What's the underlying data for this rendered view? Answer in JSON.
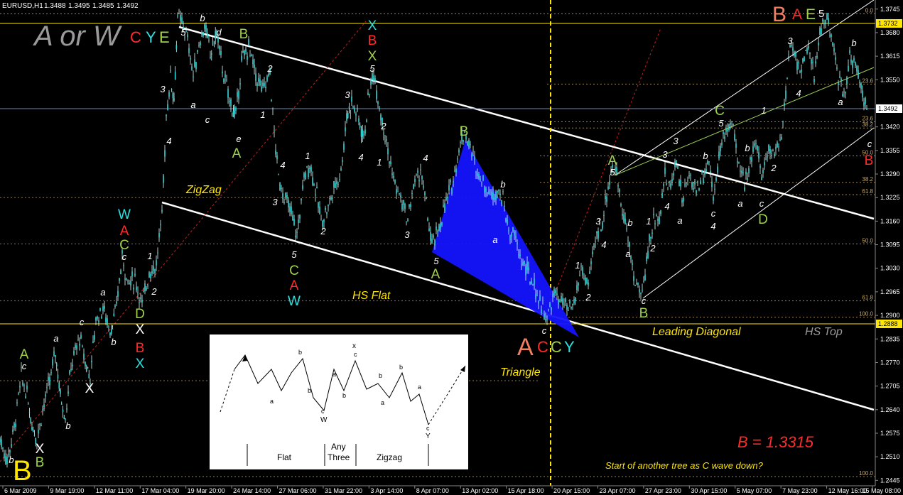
{
  "chart_data": {
    "type": "candlestick",
    "symbol": "EURUSD,H1",
    "ohlc": [
      "1.3488",
      "1.3495",
      "1.3485",
      "1.3492"
    ],
    "ylim": [
      1.243,
      1.377
    ],
    "y_ticks": [
      "1.3745",
      "1.3680",
      "1.3615",
      "1.3550",
      "1.3420",
      "1.3355",
      "1.3290",
      "1.3225",
      "1.3160",
      "1.3095",
      "1.3030",
      "1.2965",
      "1.2900",
      "1.2835",
      "1.2770",
      "1.2705",
      "1.2640",
      "1.2575",
      "1.2510",
      "1.2445"
    ],
    "current_price": "1.3492",
    "top_price": "1.3732",
    "low_price": "1.2888",
    "x_ticks": [
      "6 Mar 2009",
      "9 Mar 19:00",
      "12 Mar 11:00",
      "17 Mar 04:00",
      "19 Mar 20:00",
      "24 Mar 14:00",
      "27 Mar 06:00",
      "31 Mar 22:00",
      "3 Apr 14:00",
      "8 Apr 07:00",
      "13 Apr 02:00",
      "15 Apr 18:00",
      "20 Apr 15:00",
      "23 Apr 07:00",
      "27 Apr 23:00",
      "30 Apr 15:00",
      "5 May 07:00",
      "7 May 23:00",
      "12 May 16:00",
      "15 May 08:00"
    ],
    "fib_levels": [
      {
        "label": "0.0",
        "price": 1.3732
      },
      {
        "label": "23.6",
        "price": 1.3434
      },
      {
        "label": "38.2",
        "price": 1.3417
      },
      {
        "label": "50.0",
        "price": 1.334
      },
      {
        "label": "38.2",
        "price": 1.3267
      },
      {
        "label": "61.8",
        "price": 1.3233
      },
      {
        "label": "50.0",
        "price": 1.3097
      },
      {
        "label": "61.8",
        "price": 1.294
      },
      {
        "label": "100.0",
        "price": 1.2895
      },
      {
        "label": "100.0",
        "price": 1.2455
      },
      {
        "label": "23.6",
        "price": 1.3538
      }
    ],
    "price_path": [
      [
        0,
        1.256
      ],
      [
        10,
        1.25
      ],
      [
        20,
        1.259
      ],
      [
        30,
        1.273
      ],
      [
        38,
        1.268
      ],
      [
        45,
        1.26
      ],
      [
        52,
        1.256
      ],
      [
        60,
        1.264
      ],
      [
        70,
        1.272
      ],
      [
        78,
        1.28
      ],
      [
        85,
        1.268
      ],
      [
        92,
        1.262
      ],
      [
        100,
        1.276
      ],
      [
        112,
        1.284
      ],
      [
        120,
        1.277
      ],
      [
        127,
        1.273
      ],
      [
        135,
        1.289
      ],
      [
        145,
        1.292
      ],
      [
        155,
        1.286
      ],
      [
        162,
        1.29
      ],
      [
        172,
        1.306
      ],
      [
        180,
        1.299
      ],
      [
        190,
        1.3
      ],
      [
        200,
        1.293
      ],
      [
        210,
        1.302
      ],
      [
        220,
        1.304
      ],
      [
        228,
        1.318
      ],
      [
        234,
        1.345
      ],
      [
        240,
        1.356
      ],
      [
        245,
        1.35
      ],
      [
        250,
        1.372
      ],
      [
        258,
        1.37
      ],
      [
        266,
        1.364
      ],
      [
        272,
        1.356
      ],
      [
        280,
        1.365
      ],
      [
        288,
        1.37
      ],
      [
        296,
        1.362
      ],
      [
        305,
        1.368
      ],
      [
        315,
        1.356
      ],
      [
        325,
        1.348
      ],
      [
        332,
        1.345
      ],
      [
        340,
        1.36
      ],
      [
        350,
        1.364
      ],
      [
        360,
        1.356
      ],
      [
        370,
        1.352
      ],
      [
        380,
        1.357
      ],
      [
        386,
        1.34
      ],
      [
        392,
        1.328
      ],
      [
        400,
        1.323
      ],
      [
        410,
        1.318
      ],
      [
        418,
        1.312
      ],
      [
        428,
        1.328
      ],
      [
        436,
        1.332
      ],
      [
        444,
        1.325
      ],
      [
        452,
        1.316
      ],
      [
        462,
        1.32
      ],
      [
        470,
        1.325
      ],
      [
        480,
        1.33
      ],
      [
        488,
        1.345
      ],
      [
        495,
        1.349
      ],
      [
        505,
        1.344
      ],
      [
        512,
        1.339
      ],
      [
        520,
        1.352
      ],
      [
        526,
        1.357
      ],
      [
        534,
        1.348
      ],
      [
        540,
        1.342
      ],
      [
        548,
        1.333
      ],
      [
        556,
        1.326
      ],
      [
        566,
        1.321
      ],
      [
        574,
        1.316
      ],
      [
        582,
        1.326
      ],
      [
        592,
        1.33
      ],
      [
        600,
        1.32
      ],
      [
        608,
        1.309
      ],
      [
        616,
        1.313
      ],
      [
        626,
        1.32
      ],
      [
        636,
        1.326
      ],
      [
        646,
        1.336
      ],
      [
        654,
        1.341
      ],
      [
        662,
        1.336
      ],
      [
        672,
        1.33
      ],
      [
        682,
        1.326
      ],
      [
        692,
        1.323
      ],
      [
        700,
        1.325
      ],
      [
        708,
        1.322
      ],
      [
        716,
        1.313
      ],
      [
        724,
        1.312
      ],
      [
        732,
        1.306
      ],
      [
        742,
        1.302
      ],
      [
        752,
        1.298
      ],
      [
        762,
        1.293
      ],
      [
        770,
        1.289
      ],
      [
        780,
        1.296
      ],
      [
        790,
        1.294
      ],
      [
        800,
        1.291
      ],
      [
        808,
        1.293
      ],
      [
        818,
        1.303
      ],
      [
        828,
        1.298
      ],
      [
        838,
        1.311
      ],
      [
        848,
        1.316
      ],
      [
        856,
        1.326
      ],
      [
        864,
        1.333
      ],
      [
        872,
        1.324
      ],
      [
        880,
        1.316
      ],
      [
        886,
        1.308
      ],
      [
        894,
        1.299
      ],
      [
        904,
        1.296
      ],
      [
        912,
        1.308
      ],
      [
        920,
        1.316
      ],
      [
        928,
        1.318
      ],
      [
        936,
        1.328
      ],
      [
        944,
        1.325
      ],
      [
        952,
        1.334
      ],
      [
        960,
        1.322
      ],
      [
        970,
        1.328
      ],
      [
        980,
        1.325
      ],
      [
        990,
        1.329
      ],
      [
        998,
        1.333
      ],
      [
        1004,
        1.323
      ],
      [
        1012,
        1.334
      ],
      [
        1020,
        1.34
      ],
      [
        1030,
        1.344
      ],
      [
        1040,
        1.33
      ],
      [
        1048,
        1.327
      ],
      [
        1056,
        1.333
      ],
      [
        1064,
        1.338
      ],
      [
        1072,
        1.328
      ],
      [
        1080,
        1.336
      ],
      [
        1090,
        1.335
      ],
      [
        1100,
        1.34
      ],
      [
        1106,
        1.35
      ],
      [
        1112,
        1.366
      ],
      [
        1120,
        1.361
      ],
      [
        1128,
        1.358
      ],
      [
        1136,
        1.364
      ],
      [
        1146,
        1.356
      ],
      [
        1156,
        1.37
      ],
      [
        1164,
        1.372
      ],
      [
        1172,
        1.364
      ],
      [
        1180,
        1.356
      ],
      [
        1188,
        1.35
      ],
      [
        1196,
        1.362
      ],
      [
        1206,
        1.358
      ],
      [
        1214,
        1.352
      ],
      [
        1222,
        1.345
      ]
    ]
  },
  "labels": {
    "a_or_w": "A or W",
    "c": "C",
    "y": "Y",
    "e": "E",
    "top_b": "B",
    "top_a": "A",
    "top_e": "E",
    "top_5": "5",
    "zigzag": "ZigZag",
    "hs_flat": "HS Flat",
    "triangle": "Triangle",
    "leading_diagonal": "Leading Diagonal",
    "hs_top": "HS Top",
    "b_value": "B = 1.3315",
    "question": "Start of another tree  as C wave down?",
    "big_a": "A",
    "big_b": "B"
  },
  "wave_labels": [
    {
      "t": "b",
      "x": 285,
      "y": 30,
      "c": "#ffffff",
      "s": 13
    },
    {
      "t": "5",
      "x": 258,
      "y": 50,
      "c": "#ffffff",
      "s": 13
    },
    {
      "t": "d",
      "x": 308,
      "y": 50,
      "c": "#ffffff",
      "s": 13
    },
    {
      "t": "B",
      "x": 343,
      "y": 54,
      "c": "#9fd24a",
      "s": 19
    },
    {
      "t": "X",
      "x": 524,
      "y": 42,
      "c": "#2be0e0",
      "s": 19
    },
    {
      "t": "B",
      "x": 524,
      "y": 63,
      "c": "#ff2a2a",
      "s": 19
    },
    {
      "t": "X",
      "x": 524,
      "y": 85,
      "c": "#9fd24a",
      "s": 19
    },
    {
      "t": "5",
      "x": 524,
      "y": 101,
      "c": "#ffffff",
      "s": 13
    },
    {
      "t": "3",
      "x": 229,
      "y": 130,
      "c": "#ffffff",
      "s": 13
    },
    {
      "t": "a",
      "x": 272,
      "y": 152,
      "c": "#ffffff",
      "s": 13
    },
    {
      "t": "c",
      "x": 292,
      "y": 173,
      "c": "#ffffff",
      "s": 13
    },
    {
      "t": "1",
      "x": 370,
      "y": 166,
      "c": "#ffffff",
      "s": 13
    },
    {
      "t": "2",
      "x": 380,
      "y": 101,
      "c": "#ffffff",
      "s": 13
    },
    {
      "t": "e",
      "x": 336,
      "y": 200,
      "c": "#ffffff",
      "s": 13
    },
    {
      "t": "A",
      "x": 333,
      "y": 222,
      "c": "#9fd24a",
      "s": 19
    },
    {
      "t": "4",
      "x": 238,
      "y": 203,
      "c": "#ffffff",
      "s": 13
    },
    {
      "t": "3",
      "x": 489,
      "y": 138,
      "c": "#ffffff",
      "s": 13
    },
    {
      "t": "2",
      "x": 540,
      "y": 182,
      "c": "#ffffff",
      "s": 13
    },
    {
      "t": "1",
      "x": 534,
      "y": 233,
      "c": "#ffffff",
      "s": 13
    },
    {
      "t": "4",
      "x": 508,
      "y": 226,
      "c": "#ffffff",
      "s": 13
    },
    {
      "t": "1",
      "x": 433,
      "y": 224,
      "c": "#ffffff",
      "s": 13
    },
    {
      "t": "4",
      "x": 398,
      "y": 237,
      "c": "#ffffff",
      "s": 13
    },
    {
      "t": "3",
      "x": 387,
      "y": 289,
      "c": "#ffffff",
      "s": 13
    },
    {
      "t": "2",
      "x": 455,
      "y": 330,
      "c": "#ffffff",
      "s": 13
    },
    {
      "t": "3",
      "x": 573,
      "y": 335,
      "c": "#ffffff",
      "s": 13
    },
    {
      "t": "4",
      "x": 599,
      "y": 227,
      "c": "#ffffff",
      "s": 13
    },
    {
      "t": "5",
      "x": 414,
      "y": 363,
      "c": "#ffffff",
      "s": 13
    },
    {
      "t": "C",
      "x": 414,
      "y": 387,
      "c": "#9fd24a",
      "s": 19
    },
    {
      "t": "A",
      "x": 414,
      "y": 408,
      "c": "#ff2a2a",
      "s": 19
    },
    {
      "t": "W",
      "x": 414,
      "y": 430,
      "c": "#2be0e0",
      "s": 19
    },
    {
      "t": "B",
      "x": 653,
      "y": 191,
      "c": "#9fd24a",
      "s": 19
    },
    {
      "t": "b",
      "x": 708,
      "y": 264,
      "c": "#ffffff",
      "s": 13
    },
    {
      "t": "a",
      "x": 697,
      "y": 342,
      "c": "#ffffff",
      "s": 13
    },
    {
      "t": "5",
      "x": 614,
      "y": 372,
      "c": "#ffffff",
      "s": 13
    },
    {
      "t": "A",
      "x": 613,
      "y": 392,
      "c": "#9fd24a",
      "s": 19
    },
    {
      "t": "c",
      "x": 766,
      "y": 470,
      "c": "#ffffff",
      "s": 13
    },
    {
      "t": "W",
      "x": 175,
      "y": 308,
      "c": "#2be0e0",
      "s": 19
    },
    {
      "t": "A",
      "x": 175,
      "y": 331,
      "c": "#ff2a2a",
      "s": 19
    },
    {
      "t": "C",
      "x": 175,
      "y": 351,
      "c": "#9fd24a",
      "s": 19
    },
    {
      "t": "c",
      "x": 175,
      "y": 366,
      "c": "#ffffff",
      "s": 13
    },
    {
      "t": "a",
      "x": 145,
      "y": 416,
      "c": "#ffffff",
      "s": 13
    },
    {
      "t": "1",
      "x": 211,
      "y": 365,
      "c": "#ffffff",
      "s": 13
    },
    {
      "t": "2",
      "x": 217,
      "y": 415,
      "c": "#ffffff",
      "s": 13
    },
    {
      "t": "D",
      "x": 197,
      "y": 448,
      "c": "#9fd24a",
      "s": 19
    },
    {
      "t": "X",
      "x": 197,
      "y": 470,
      "c": "#ffffff",
      "s": 19
    },
    {
      "t": "B",
      "x": 197,
      "y": 496,
      "c": "#ff2a2a",
      "s": 19
    },
    {
      "t": "X",
      "x": 197,
      "y": 518,
      "c": "#2be0e0",
      "s": 19
    },
    {
      "t": "c",
      "x": 115,
      "y": 458,
      "c": "#ffffff",
      "s": 13
    },
    {
      "t": "a",
      "x": 79,
      "y": 481,
      "c": "#ffffff",
      "s": 13
    },
    {
      "t": "b",
      "x": 160,
      "y": 486,
      "c": "#ffffff",
      "s": 13
    },
    {
      "t": "X",
      "x": 126,
      "y": 553,
      "c": "#ffffff",
      "s": 19
    },
    {
      "t": "b",
      "x": 96,
      "y": 604,
      "c": "#ffffff",
      "s": 13
    },
    {
      "t": "A",
      "x": 34,
      "y": 505,
      "c": "#9fd24a",
      "s": 19
    },
    {
      "t": "c",
      "x": 34,
      "y": 520,
      "c": "#ffffff",
      "s": 13
    },
    {
      "t": "X",
      "x": 56,
      "y": 638,
      "c": "#ffffff",
      "s": 19
    },
    {
      "t": "B",
      "x": 56,
      "y": 657,
      "c": "#9fd24a",
      "s": 19
    },
    {
      "t": "b",
      "x": 16,
      "y": 652,
      "c": "#ffffff",
      "s": 13
    },
    {
      "t": "A",
      "x": 862,
      "y": 232,
      "c": "#9fd24a",
      "s": 19
    },
    {
      "t": "5",
      "x": 862,
      "y": 247,
      "c": "#ffffff",
      "s": 13
    },
    {
      "t": "3",
      "x": 842,
      "y": 316,
      "c": "#ffffff",
      "s": 13
    },
    {
      "t": "4",
      "x": 850,
      "y": 349,
      "c": "#ffffff",
      "s": 13
    },
    {
      "t": "1",
      "x": 813,
      "y": 378,
      "c": "#ffffff",
      "s": 13
    },
    {
      "t": "2",
      "x": 828,
      "y": 423,
      "c": "#ffffff",
      "s": 13
    },
    {
      "t": "b",
      "x": 887,
      "y": 318,
      "c": "#ffffff",
      "s": 13
    },
    {
      "t": "a",
      "x": 884,
      "y": 362,
      "c": "#ffffff",
      "s": 13
    },
    {
      "t": "c",
      "x": 906,
      "y": 428,
      "c": "#ffffff",
      "s": 13
    },
    {
      "t": "B",
      "x": 906,
      "y": 447,
      "c": "#9fd24a",
      "s": 19
    },
    {
      "t": "1",
      "x": 913,
      "y": 316,
      "c": "#ffffff",
      "s": 13
    },
    {
      "t": "2",
      "x": 919,
      "y": 354,
      "c": "#ffffff",
      "s": 13
    },
    {
      "t": "3",
      "x": 936,
      "y": 222,
      "c": "#ffffff",
      "s": 13
    },
    {
      "t": "3",
      "x": 951,
      "y": 203,
      "c": "#ffffff",
      "s": 13
    },
    {
      "t": "4",
      "x": 939,
      "y": 295,
      "c": "#ffffff",
      "s": 13
    },
    {
      "t": "a",
      "x": 957,
      "y": 315,
      "c": "#ffffff",
      "s": 13
    },
    {
      "t": "b",
      "x": 993,
      "y": 224,
      "c": "#ffffff",
      "s": 13
    },
    {
      "t": "c",
      "x": 1004,
      "y": 305,
      "c": "#ffffff",
      "s": 13
    },
    {
      "t": "4",
      "x": 1004,
      "y": 323,
      "c": "#ffffff",
      "s": 13
    },
    {
      "t": "C",
      "x": 1013,
      "y": 162,
      "c": "#9fd24a",
      "s": 19
    },
    {
      "t": "5",
      "x": 1015,
      "y": 178,
      "c": "#ffffff",
      "s": 13
    },
    {
      "t": "b",
      "x": 1052,
      "y": 213,
      "c": "#ffffff",
      "s": 13
    },
    {
      "t": "a",
      "x": 1042,
      "y": 291,
      "c": "#ffffff",
      "s": 13
    },
    {
      "t": "c",
      "x": 1072,
      "y": 291,
      "c": "#ffffff",
      "s": 13
    },
    {
      "t": "D",
      "x": 1074,
      "y": 315,
      "c": "#9fd24a",
      "s": 19
    },
    {
      "t": "1",
      "x": 1075,
      "y": 160,
      "c": "#ffffff",
      "s": 13
    },
    {
      "t": "2",
      "x": 1089,
      "y": 241,
      "c": "#ffffff",
      "s": 13
    },
    {
      "t": "3",
      "x": 1112,
      "y": 62,
      "c": "#ffffff",
      "s": 13
    },
    {
      "t": "4",
      "x": 1124,
      "y": 136,
      "c": "#ffffff",
      "s": 13
    },
    {
      "t": "b",
      "x": 1202,
      "y": 65,
      "c": "#ffffff",
      "s": 13
    },
    {
      "t": "a",
      "x": 1183,
      "y": 148,
      "c": "#ffffff",
      "s": 13
    },
    {
      "t": "c",
      "x": 1224,
      "y": 207,
      "c": "#ffffff",
      "s": 13
    },
    {
      "t": "B",
      "x": 1223,
      "y": 232,
      "c": "#ff2a2a",
      "s": 19
    }
  ],
  "inset": {
    "labels": [
      "b",
      "a",
      "b",
      "a",
      "c",
      "W",
      "x",
      "c",
      "a",
      "b",
      "b",
      "a",
      "c",
      "Y",
      "b"
    ],
    "flat": "Flat",
    "any": "Any",
    "three": "Three",
    "zigzag": "Zigzag"
  },
  "colors": {
    "candle": "#2fd8d8",
    "triangle": "#1414ff",
    "yellow": "#ffe600",
    "fib": "#c8a86a",
    "grid": "#808080"
  }
}
